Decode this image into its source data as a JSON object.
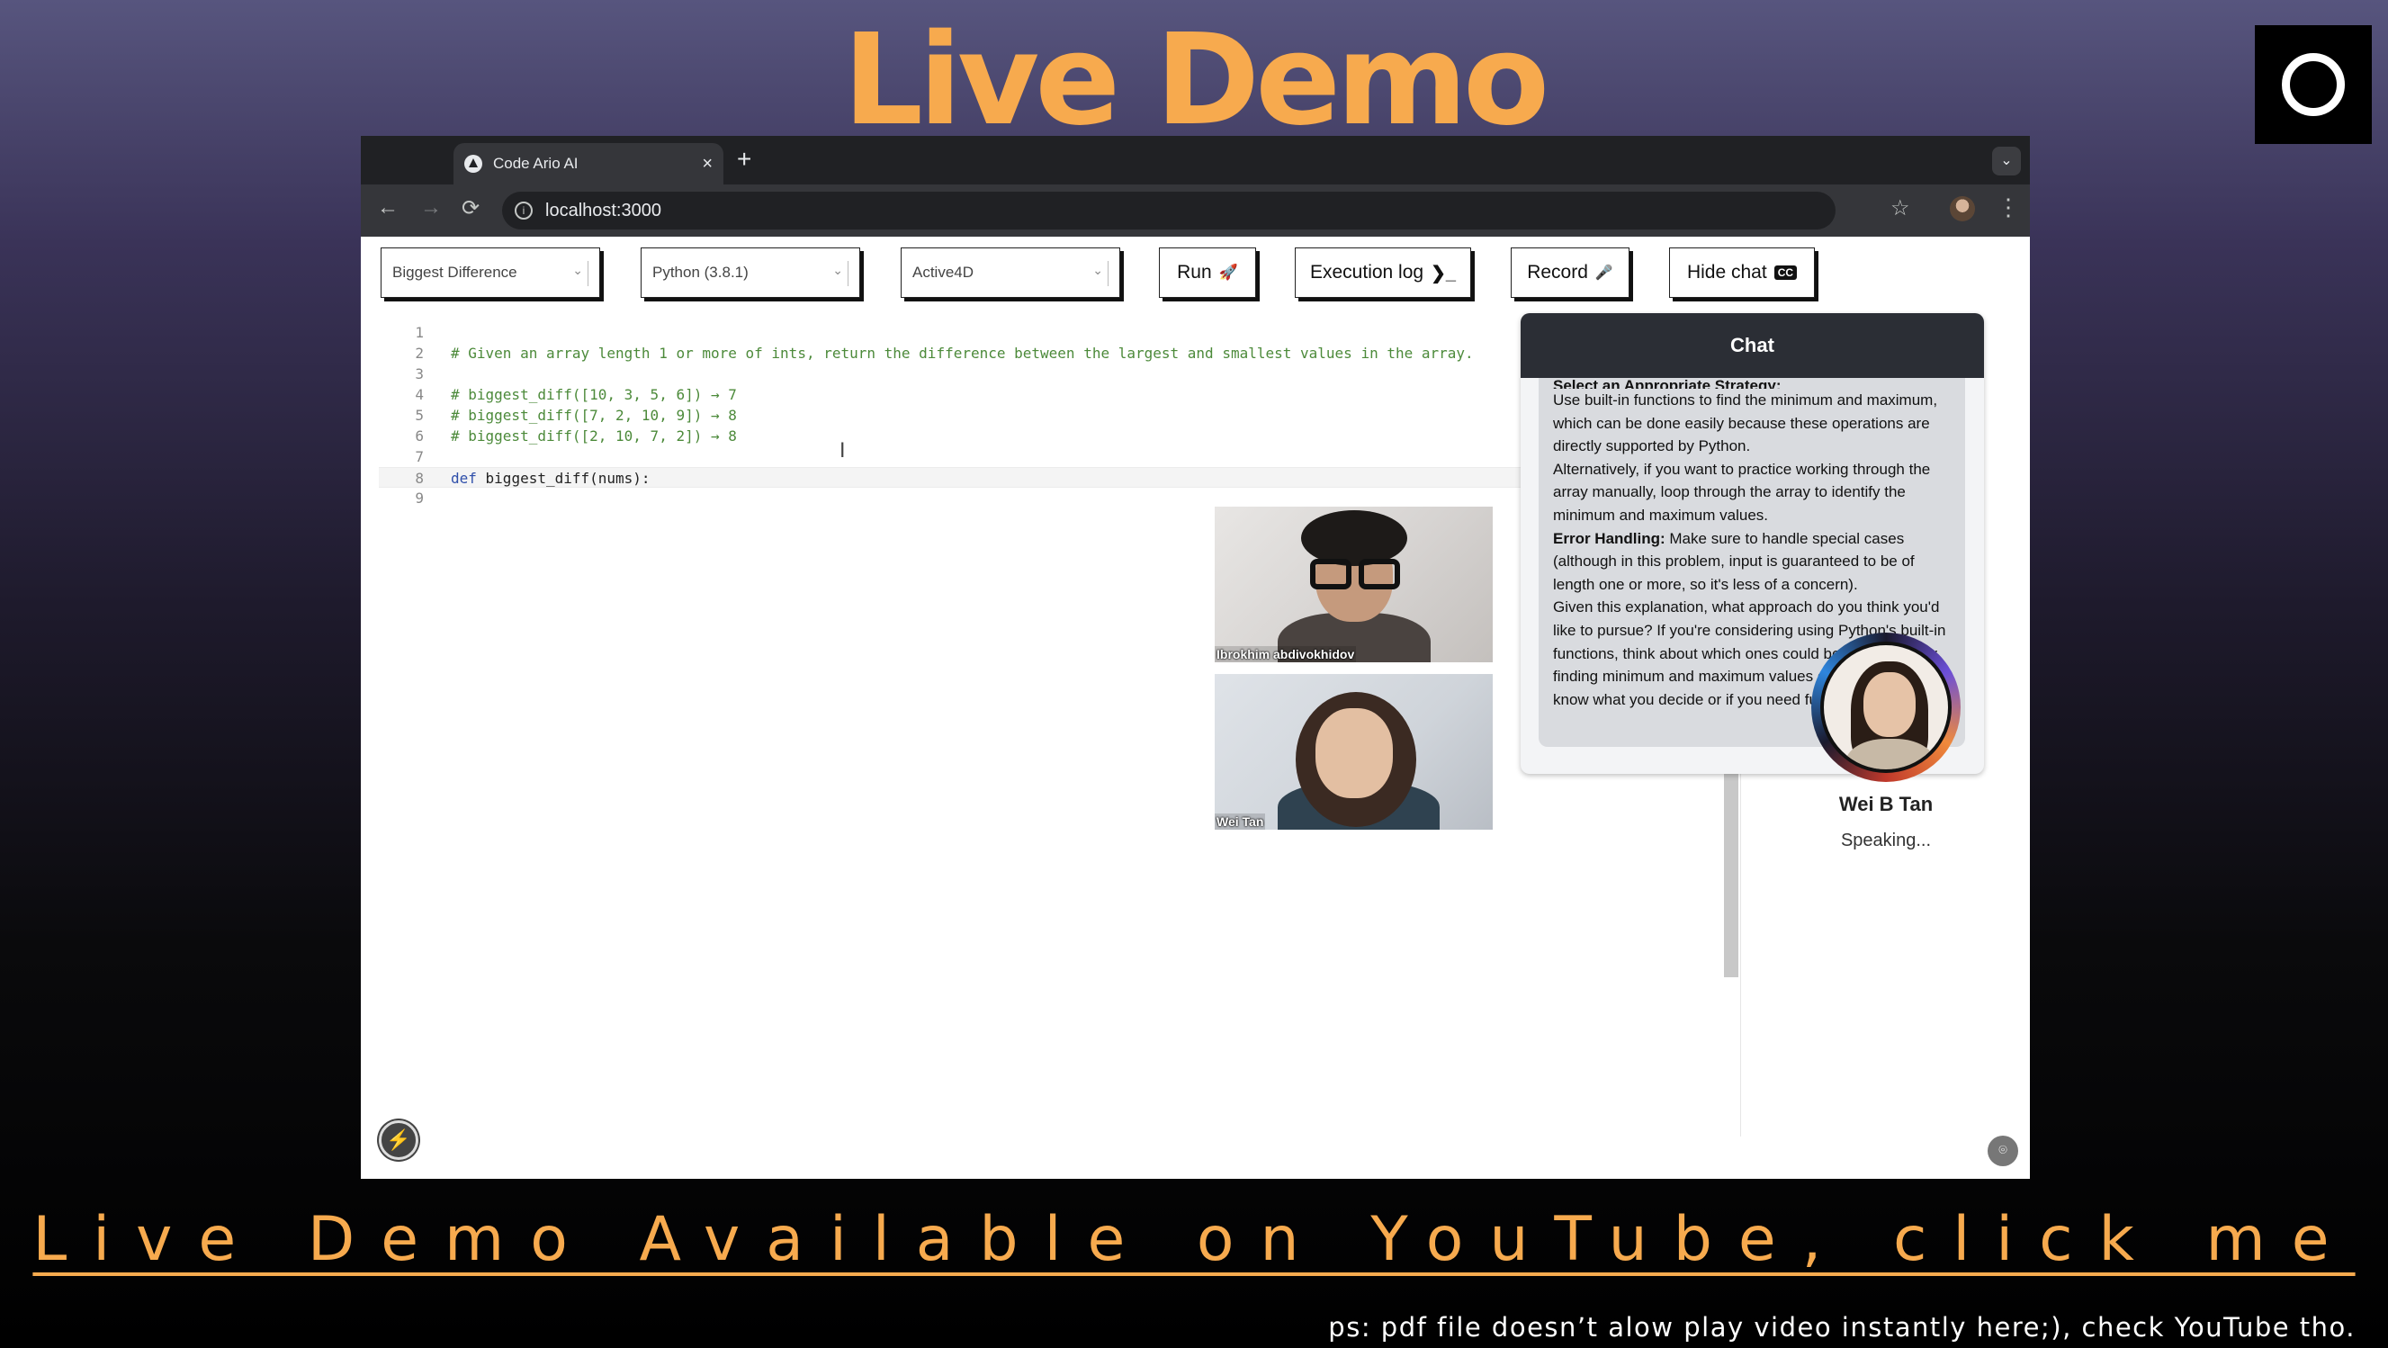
{
  "slide": {
    "title": "Live Demo",
    "link_text": "Live Demo Available on YouTube, click me",
    "footnote": "ps: pdf file doesn’t alow play video instantly here;), check YouTube tho.",
    "accent_color": "#f7aa4e"
  },
  "browser": {
    "tab_title": "Code Ario AI",
    "tab_close": "×",
    "new_tab": "+",
    "url": "localhost:3000",
    "icons": {
      "back": "←",
      "forward": "→",
      "reload": "⟳",
      "info": "i",
      "star": "☆",
      "menu": "⋮",
      "tab_search": "⌄"
    }
  },
  "toolbar": {
    "problem_select": "Biggest Difference",
    "language_select": "Python (3.8.1)",
    "theme_select": "Active4D",
    "run_label": "Run",
    "exec_log_label": "Execution log",
    "record_label": "Record",
    "hide_chat_label": "Hide chat",
    "icons": {
      "run": "🚀",
      "exec_log": "❯_",
      "record": "🎤",
      "cc": "CC",
      "chevron": "⌄"
    }
  },
  "editor": {
    "lines": [
      {
        "n": "1",
        "text": ""
      },
      {
        "n": "2",
        "text": "# Given an array length 1 or more of ints, return the difference between the largest and smallest values in the array."
      },
      {
        "n": "3",
        "text": ""
      },
      {
        "n": "4",
        "text": "# biggest_diff([10, 3, 5, 6]) → 7"
      },
      {
        "n": "5",
        "text": "# biggest_diff([7, 2, 10, 9]) → 8"
      },
      {
        "n": "6",
        "text": "# biggest_diff([2, 10, 7, 2]) → 8"
      },
      {
        "n": "7",
        "text": ""
      },
      {
        "n": "8",
        "keyword": "def",
        "text": " biggest_diff(nums):"
      },
      {
        "n": "9",
        "text": ""
      }
    ],
    "cursor_glyph": "I"
  },
  "videos": [
    {
      "label": "Ibrokhim abdivokhidov"
    },
    {
      "label": "Wei Tan"
    }
  ],
  "chat": {
    "title": "Chat",
    "clipped_heading": "Select an Appropriate Strategy:",
    "p1": "Use built-in functions to find the minimum and maximum, which can be done easily because these operations are directly supported by Python.",
    "p2": "Alternatively, if you want to practice working through the array manually, loop through the array to identify the minimum and maximum values.",
    "p3_bold": "Error Handling:",
    "p3_rest": " Make sure to handle special cases (although in this problem, input is guaranteed to be of length one or more, so it's less of a concern).",
    "p4": "Given this explanation, what approach do you think you'd like to pursue? If you're considering using Python's built-in functions, think about which ones could be the best fit for finding minimum and maximum values directly. Let me know what you decide or if you need further assistance!"
  },
  "speaker": {
    "name": "Wei B Tan",
    "status": "Speaking..."
  },
  "floating": {
    "bolt": "⚡",
    "capture": "⌾"
  }
}
